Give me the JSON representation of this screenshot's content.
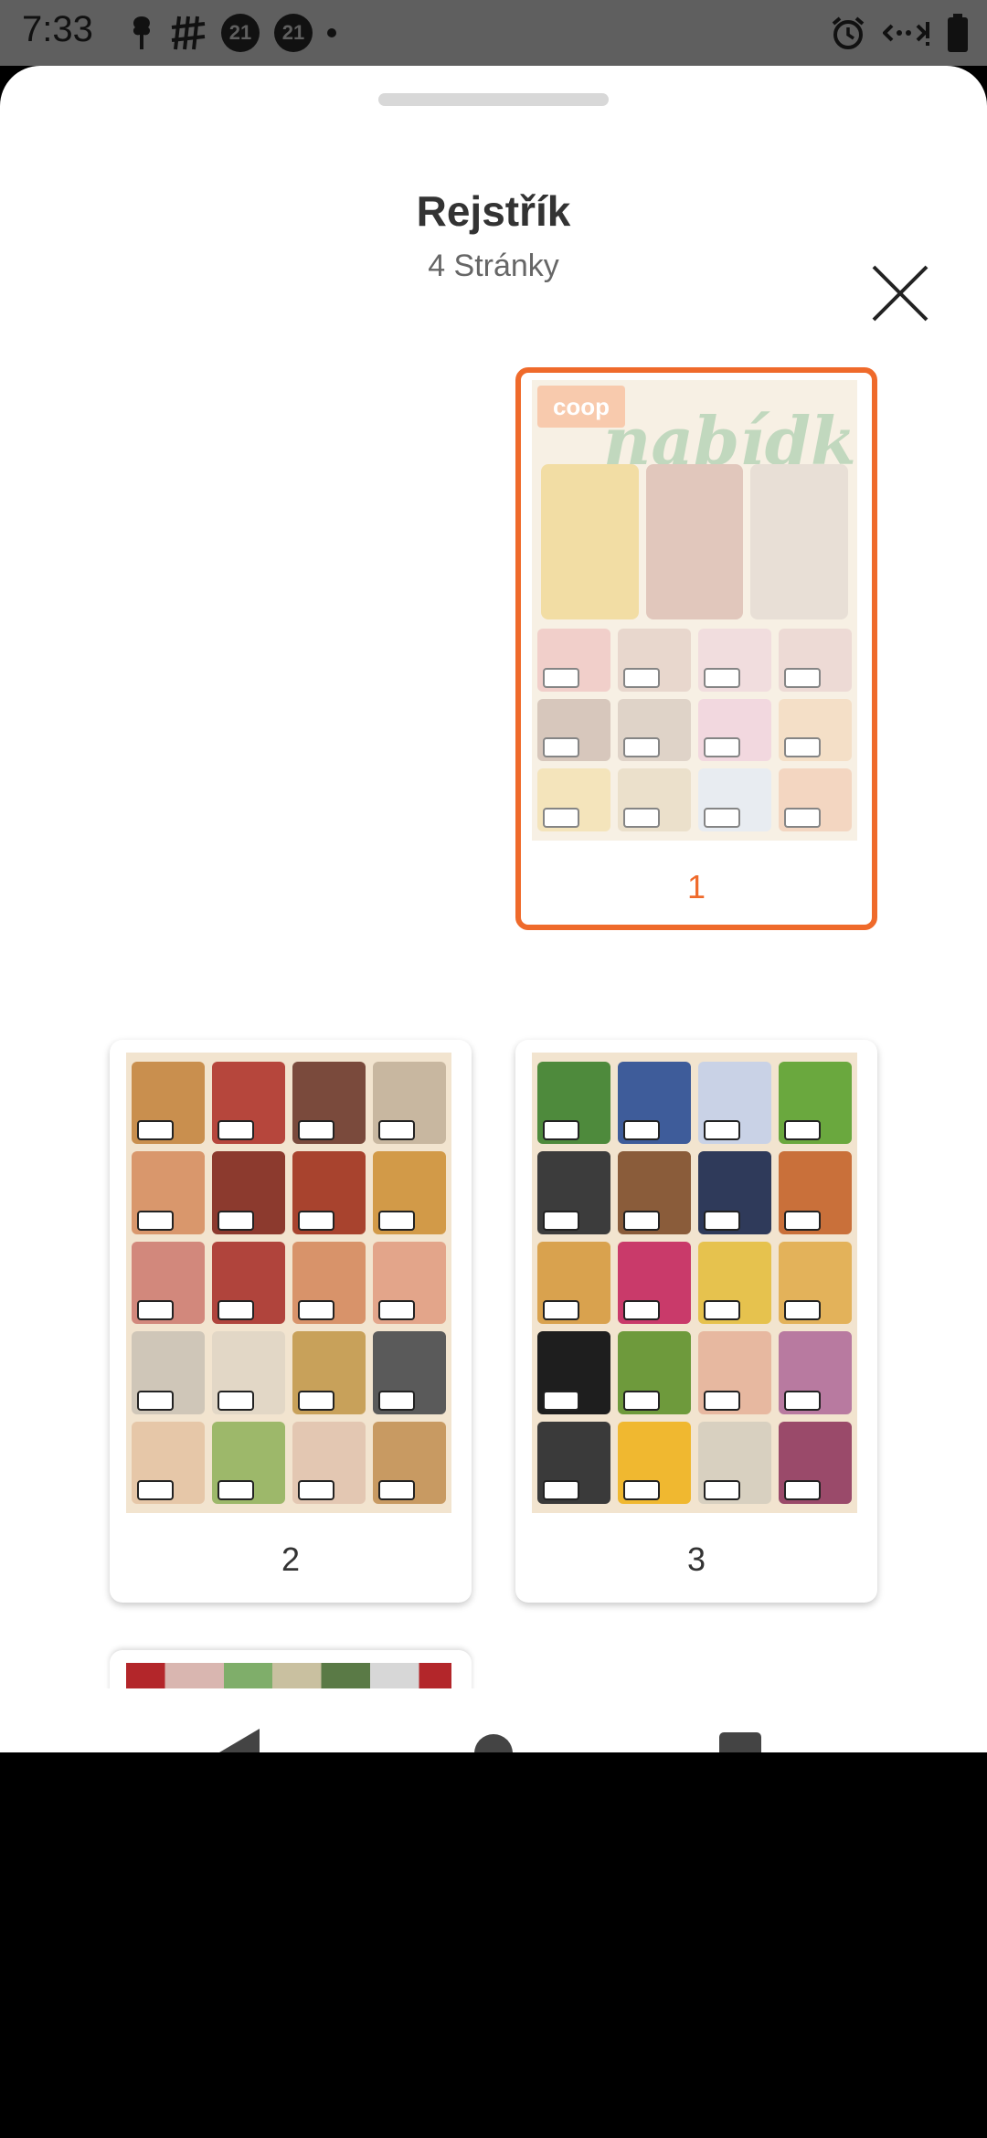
{
  "status_bar": {
    "time": "7:33",
    "badge_1": "21",
    "badge_2": "21",
    "icons_left": [
      "notification-icon",
      "hashtag-icon",
      "badge-21-icon",
      "badge-21-icon",
      "dot-icon"
    ],
    "icons_right": [
      "alarm-icon",
      "data-saver-icon",
      "battery-icon"
    ]
  },
  "sheet": {
    "title": "Rejstřík",
    "subtitle": "4 Stránky",
    "close_icon": "close-icon"
  },
  "pages": [
    {
      "number": "1",
      "selected": true
    },
    {
      "number": "2",
      "selected": false
    },
    {
      "number": "3",
      "selected": false
    }
  ],
  "flyer": {
    "brand": "coop",
    "headline": "nabídka"
  },
  "nav_bar": {
    "back": "back-icon",
    "home": "home-icon",
    "recents": "recents-icon"
  },
  "colors": {
    "accent": "#ef6a2b",
    "status_bar": "#5f5f5f"
  }
}
